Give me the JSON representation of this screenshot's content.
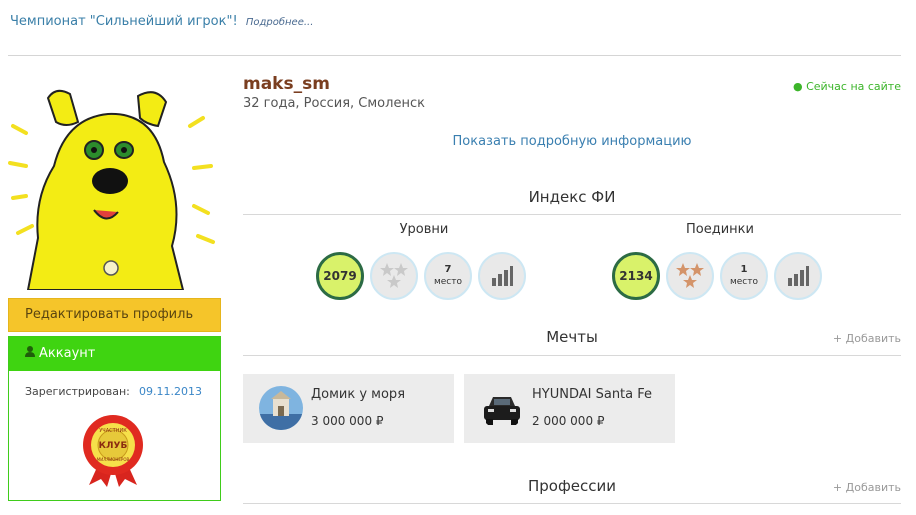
{
  "banner": {
    "text": "Чемпионат \"Сильнейший игрок\"!",
    "more": "Подробнее..."
  },
  "profile": {
    "username": "maks_sm",
    "info": "32 года, Россия, Смоленск",
    "online": "● Сейчас на сайте",
    "show_more": "Показать подробную информацию"
  },
  "sidebar": {
    "edit_label": "Редактировать профиль",
    "account_label": "Аккаунт",
    "registered_label": "Зарегистрирован:",
    "registered_date": "09.11.2013",
    "badge_text_top": "УЧАСТНИК",
    "badge_text_mid": "КЛУБ",
    "badge_text_bottom": "МИЛЛИОНЕРОВ"
  },
  "index": {
    "title": "Индекс ФИ",
    "levels": {
      "title": "Уровни",
      "score": "2079",
      "place_num": "7",
      "place_label": "место"
    },
    "duels": {
      "title": "Поединки",
      "score": "2134",
      "place_num": "1",
      "place_label": "место"
    }
  },
  "dreams": {
    "title": "Мечты",
    "add": "+ Добавить",
    "items": [
      {
        "name": "Домик у моря",
        "price": "3 000 000 ₽"
      },
      {
        "name": "HYUNDAI Santa Fe",
        "price": "2 000 000 ₽"
      }
    ]
  },
  "professions": {
    "title": "Профессии",
    "add": "+ Добавить"
  },
  "colors": {
    "accent": "#3a7fb0",
    "edit": "#f5c52a",
    "account": "#3fd411",
    "online": "#3cb52a"
  }
}
